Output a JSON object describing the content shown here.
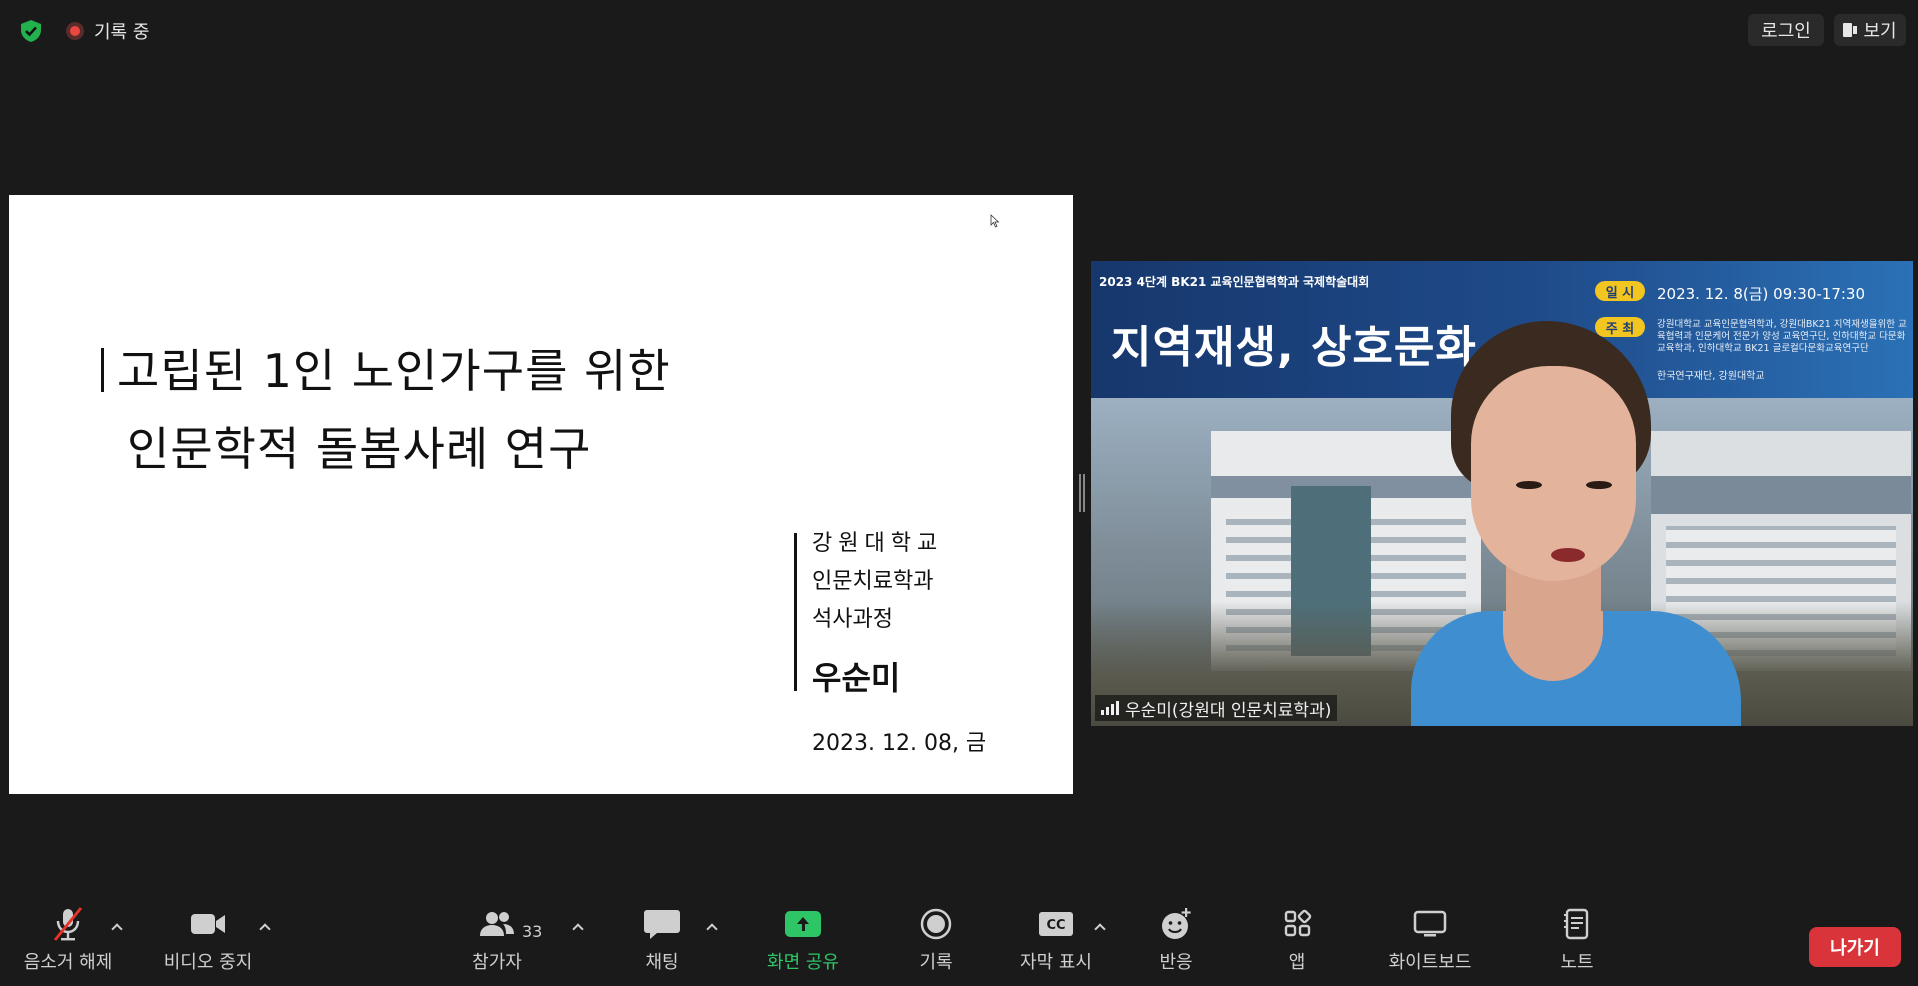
{
  "window": {
    "recording_label": "기록 중",
    "login_label": "로그인",
    "view_label": "보기"
  },
  "slide": {
    "title_line1": "고립된 1인 노인가구를 위한",
    "title_line2": "인문학적 돌봄사례 연구",
    "university": "강원대학교",
    "department": "인문치료학과",
    "program": "석사과정",
    "presenter": "우순미",
    "date": "2023. 12. 08, 금"
  },
  "video": {
    "banner_top": "2023 4단계 BK21 교육인문협력학과 국제학술대회",
    "banner_title": "지역재생, 상호문화, 치유",
    "pill_date": "일 시",
    "pill_host": "주 최",
    "banner_date": "2023. 12. 8(금) 09:30-17:30",
    "banner_desc": "강원대학교 교육인문협력학과, 강원대BK21 지역재생을위한 교육협력과 인문케어 전문가 양성 교육연구단, 인하대학교 다문화교육학과, 인하대학교 BK21 글로컬다문화교육연구단",
    "banner_sponsor": "한국연구재단, 강원대학교",
    "participant_name": "우순미(강원대 인문치료학과)"
  },
  "toolbar": {
    "mute_label": "음소거 해제",
    "video_label": "비디오 중지",
    "participants_label": "참가자",
    "participants_count": "33",
    "chat_label": "채팅",
    "share_label": "화면 공유",
    "record_label": "기록",
    "captions_label": "자막 표시",
    "reactions_label": "반응",
    "apps_label": "앱",
    "whiteboard_label": "화이트보드",
    "notes_label": "노트",
    "leave_label": "나가기",
    "share_color": "#2ec566",
    "leave_color": "#d9343a"
  },
  "icons": {
    "shield": "shield-check-icon",
    "mic": "microphone-muted-icon",
    "camera": "video-camera-icon",
    "participants": "people-icon",
    "chat": "chat-bubble-icon",
    "share": "share-screen-icon",
    "record": "record-icon",
    "captions": "cc-icon",
    "reactions": "emoji-plus-icon",
    "apps": "apps-icon",
    "whiteboard": "whiteboard-icon",
    "notes": "notes-icon"
  }
}
